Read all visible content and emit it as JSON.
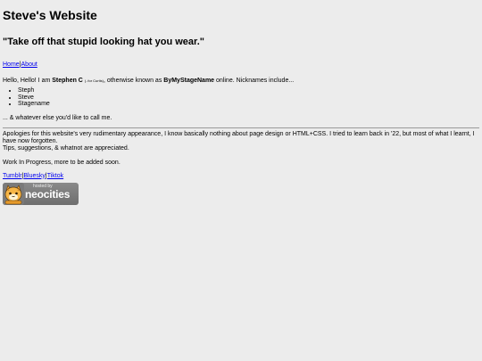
{
  "header": {
    "title": "Steve's Website",
    "quote": "\"Take off that stupid looking hat you wear.\""
  },
  "nav": {
    "links": [
      "Home",
      "About"
    ],
    "separator": "|"
  },
  "intro": {
    "greeting": "Hello, Hello! I am ",
    "name": "Stephen C",
    "name_note": "(..for Curtis)",
    "middle": ", otherwise known as ",
    "handle": "ByMyStageName",
    "end": " online. Nicknames include..."
  },
  "nicknames": [
    "Steph",
    "Steve",
    "Stagename"
  ],
  "after_list": "... & whatever else you'd like to call me.",
  "apology": {
    "line1": "Apologies for this website's very rudimentary appearance, I know basically nothing about page design or HTML+CSS. I tried to learn back in '22, but most of what I learnt, I have now forgotten.",
    "line2": "Tips, suggestions, & whatnot are appreciated."
  },
  "wip": "Work In Progress, more to be added soon.",
  "social": {
    "links": [
      "Tumblr",
      "Bluesky",
      "Tiktok"
    ],
    "separator": "|"
  },
  "badge": {
    "small": "hosted by",
    "big": "neocities",
    "icon": "neocities-cat-icon"
  }
}
